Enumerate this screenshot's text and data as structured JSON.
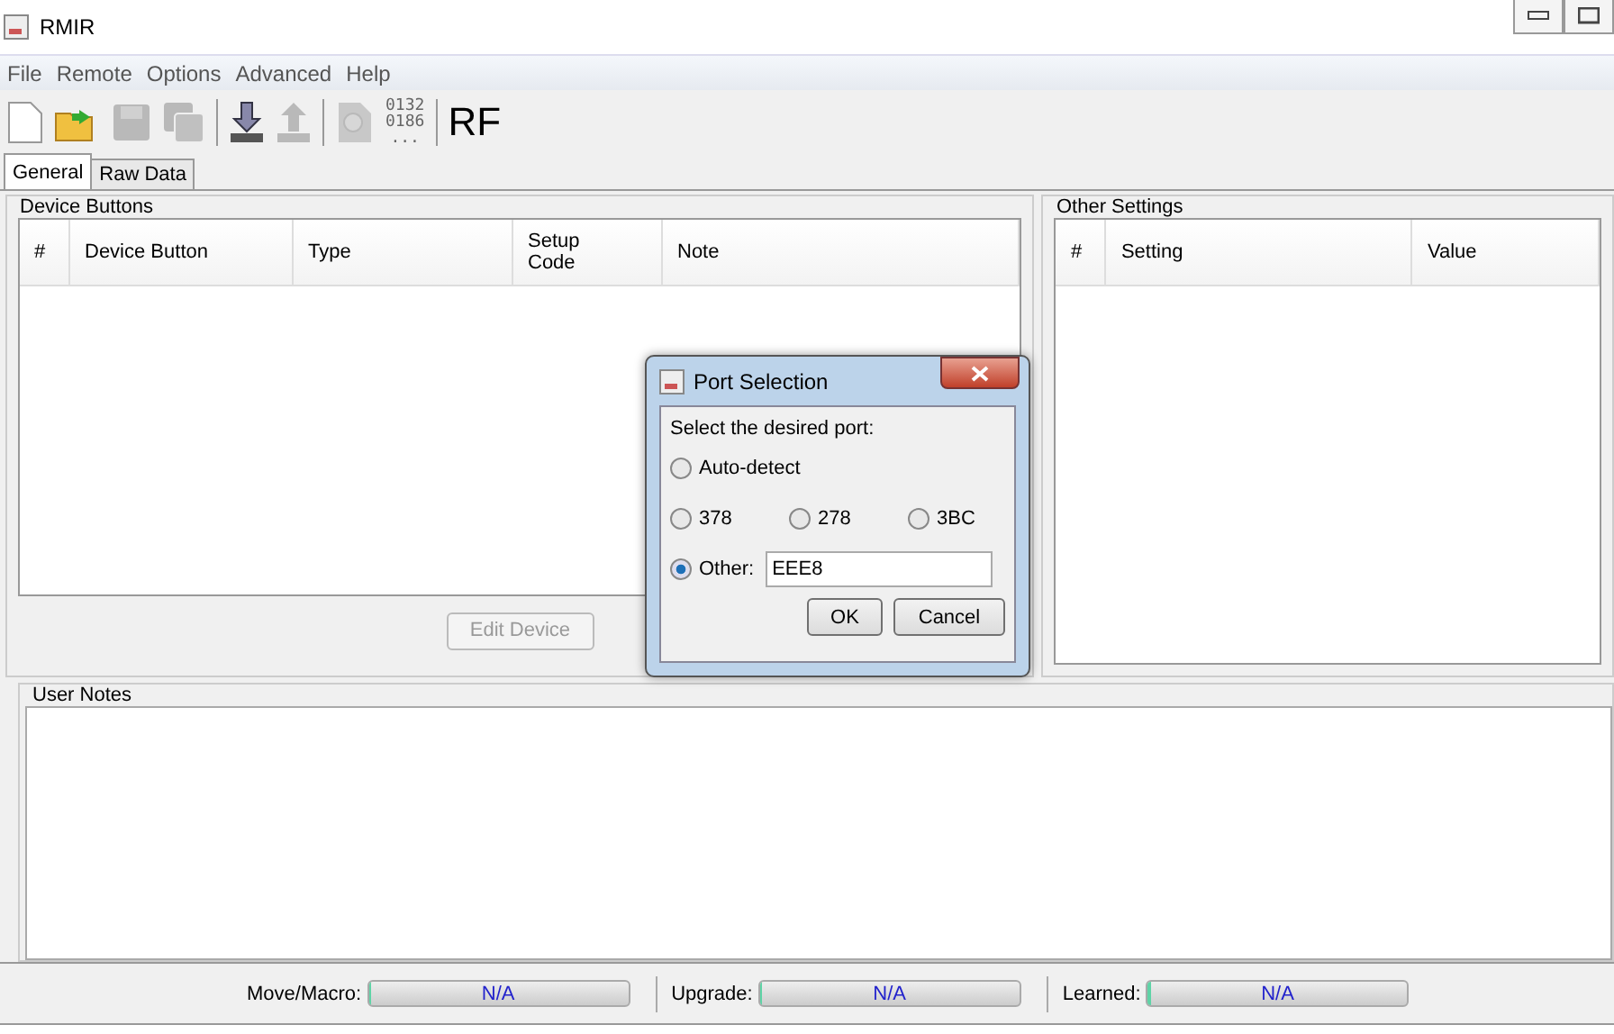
{
  "window": {
    "title": "RMIR"
  },
  "menu": [
    "File",
    "Remote",
    "Options",
    "Advanced",
    "Help"
  ],
  "toolbar": [
    {
      "kind": "new",
      "disabled": false
    },
    {
      "kind": "open",
      "disabled": false
    },
    {
      "kind": "save",
      "disabled": true
    },
    {
      "kind": "saveas",
      "disabled": true
    },
    {
      "kind": "sep"
    },
    {
      "kind": "download",
      "disabled": false
    },
    {
      "kind": "upload",
      "disabled": true
    },
    {
      "kind": "sep"
    },
    {
      "kind": "search",
      "disabled": true
    },
    {
      "kind": "text",
      "lines": [
        "0132",
        "0186",
        "..."
      ],
      "disabled": true
    },
    {
      "kind": "sep"
    },
    {
      "kind": "big",
      "label": "RF",
      "disabled": false
    }
  ],
  "tabs": [
    {
      "label": "General",
      "selected": true
    },
    {
      "label": "Raw Data",
      "selected": false
    }
  ],
  "device_buttons": {
    "title": "Device Buttons",
    "columns": [
      "#",
      "Device Button",
      "Type",
      [
        "Setup",
        "Code"
      ],
      "Note"
    ],
    "button": {
      "label": "Edit Device",
      "disabled": true
    }
  },
  "other_settings": {
    "title": "Other Settings",
    "columns": [
      "#",
      "Setting",
      "Value"
    ]
  },
  "user_notes": {
    "title": "User Notes"
  },
  "status_bar": [
    {
      "label": "Move/Macro:",
      "reading": "N/A",
      "level": 0.01
    },
    {
      "label": "Upgrade:",
      "reading": "N/A",
      "level": 0.01
    },
    {
      "label": "Learned:",
      "reading": "N/A",
      "level": 0.01
    }
  ],
  "dialog": {
    "title": "Port Selection",
    "prompt": "Select the desired port:",
    "options": [
      {
        "label": "Auto-detect",
        "selected": false
      },
      {
        "label": "378",
        "selected": false
      },
      {
        "label": "278",
        "selected": false
      },
      {
        "label": "3BC",
        "selected": false
      },
      {
        "label": "Other:",
        "selected": true
      }
    ],
    "other_value": "EEE8",
    "buttons": [
      "OK",
      "Cancel"
    ]
  }
}
